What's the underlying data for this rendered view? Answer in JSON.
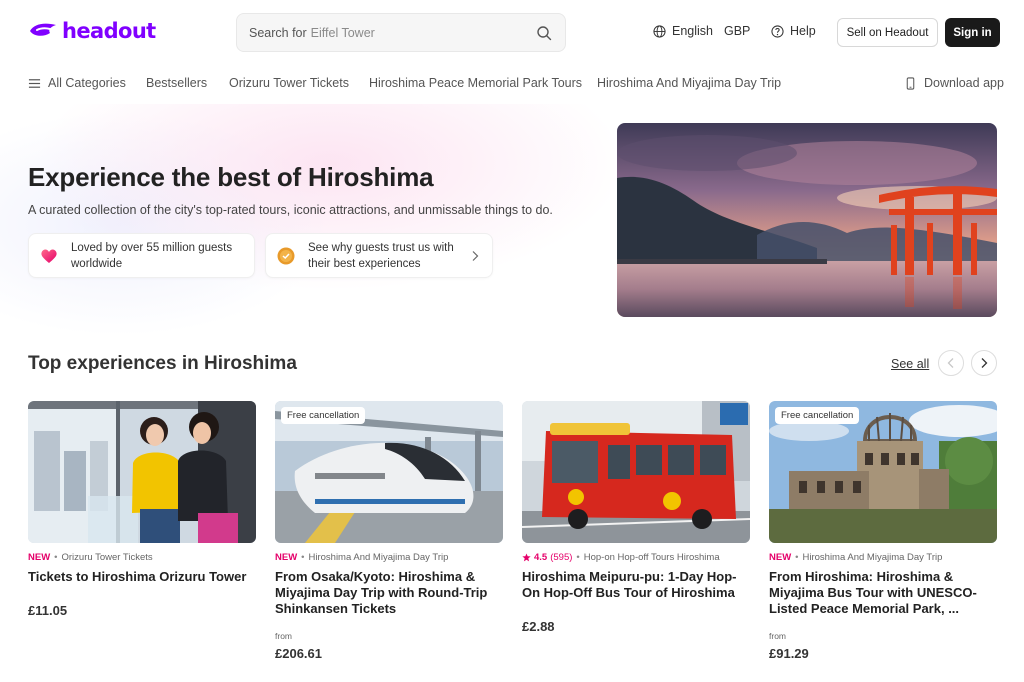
{
  "header": {
    "logo_text": "headout",
    "search_label": "Search for",
    "search_hint": "Eiffel Tower",
    "language": "English",
    "currency": "GBP",
    "help": "Help",
    "sell_button": "Sell on Headout",
    "signin_button": "Sign in",
    "brand_color": "#8000ff"
  },
  "nav": {
    "items": [
      "All Categories",
      "Bestsellers",
      "Orizuru Tower Tickets",
      "Hiroshima Peace Memorial Park Tours",
      "Hiroshima And Miyajima Day Trip"
    ],
    "download": "Download app"
  },
  "hero": {
    "title": "Experience the best of Hiroshima",
    "subtitle": "A curated collection of the city's top-rated tours, iconic attractions, and unmissable things to do.",
    "trust": [
      {
        "text": "Loved by over 55 million guests worldwide",
        "icon": "heart-icon"
      },
      {
        "text": "See why guests trust us with their best experiences",
        "icon": "medal-icon"
      }
    ]
  },
  "section": {
    "title": "Top experiences in Hiroshima",
    "see_all": "See all"
  },
  "cards": [
    {
      "badge": "",
      "tag": "NEW",
      "category": "Orizuru Tower Tickets",
      "title": "Tickets to Hiroshima Orizuru Tower",
      "from": "",
      "price": "£11.05"
    },
    {
      "badge": "Free cancellation",
      "tag": "NEW",
      "category": "Hiroshima And Miyajima Day Trip",
      "title": "From Osaka/Kyoto: Hiroshima & Miyajima Day Trip with Round-Trip Shinkansen Tickets",
      "from": "from",
      "price": "£206.61"
    },
    {
      "badge": "",
      "rating": "4.5",
      "rating_count": "(595)",
      "category": "Hop-on Hop-off Tours Hiroshima",
      "title": "Hiroshima Meipuru-pu: 1-Day Hop-On Hop-Off Bus Tour of Hiroshima",
      "from": "",
      "price": "£2.88"
    },
    {
      "badge": "Free cancellation",
      "tag": "NEW",
      "category": "Hiroshima And Miyajima Day Trip",
      "title": "From Hiroshima: Hiroshima & Miyajima Bus Tour with UNESCO-Listed Peace Memorial Park, ...",
      "from": "from",
      "price": "£91.29"
    }
  ],
  "accent_color": "#e5006a"
}
